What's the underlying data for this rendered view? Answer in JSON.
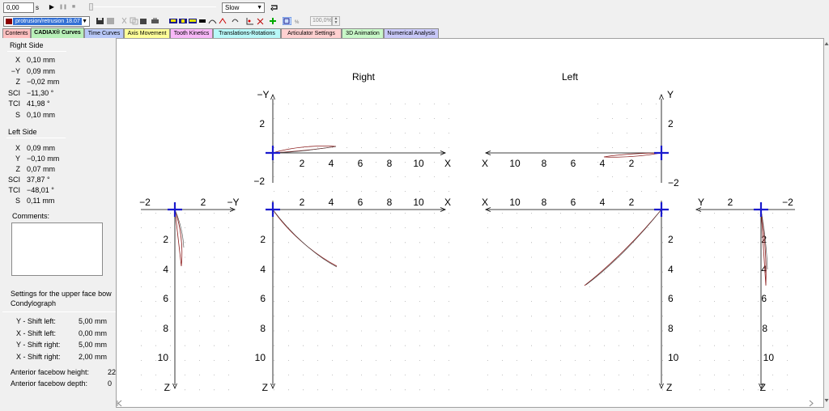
{
  "toolbar": {
    "time_value": "0,00",
    "time_unit": "s",
    "speed_value": "Slow",
    "zoom_value": "100,0%",
    "play_label": "▶",
    "pause_label": "❚❚",
    "stop_label": "■"
  },
  "motion_select": {
    "value": "protrusion/retrusion 18.07"
  },
  "tabs": [
    {
      "label": "Contents",
      "color": "#ffc0c0"
    },
    {
      "label": "CADIAX® Curves",
      "color": "#b8f0b8",
      "active": true
    },
    {
      "label": "Time Curves",
      "color": "#b8c8f8"
    },
    {
      "label": "Axis Movement",
      "color": "#ffff99"
    },
    {
      "label": "Tooth Kinetics",
      "color": "#f8b8f8"
    },
    {
      "label": "Translations-Rotations",
      "color": "#b8f8f8"
    },
    {
      "label": "Articulator Settings",
      "color": "#ffd0d0"
    },
    {
      "label": "3D Animation",
      "color": "#c8f8c8"
    },
    {
      "label": "Numerical Analysis",
      "color": "#c8c8f8"
    }
  ],
  "left_panel": {
    "right_side": {
      "title": "Right Side",
      "rows": [
        {
          "label": "X",
          "value": "0,10 mm"
        },
        {
          "label": "−Y",
          "value": "0,09 mm"
        },
        {
          "label": "Z",
          "value": "−0,02 mm"
        },
        {
          "label": "SCI",
          "value": "−11,30 °"
        },
        {
          "label": "TCI",
          "value": "41,98 °"
        },
        {
          "label": "S",
          "value": "0,10 mm"
        }
      ]
    },
    "left_side": {
      "title": "Left Side",
      "rows": [
        {
          "label": "X",
          "value": "0,09 mm"
        },
        {
          "label": "Y",
          "value": "−0,10 mm"
        },
        {
          "label": "Z",
          "value": "0,07 mm"
        },
        {
          "label": "SCI",
          "value": "37,87 °"
        },
        {
          "label": "TCI",
          "value": "−48,01 °"
        },
        {
          "label": "S",
          "value": "0,11 mm"
        }
      ]
    },
    "comments_label": "Comments:",
    "settings_title": "Settings for the upper face bow",
    "settings_subtitle": "Condylograph",
    "settings": [
      {
        "label": "Y  - Shift left:",
        "value": "5,00 mm"
      },
      {
        "label": "X  - Shift left:",
        "value": "0,00 mm"
      },
      {
        "label": "Y  - Shift right:",
        "value": "5,00 mm"
      },
      {
        "label": "X  - Shift right:",
        "value": "2,00 mm"
      }
    ],
    "facebow": [
      {
        "label": "Anterior facebow height:",
        "value": "22"
      },
      {
        "label": "Anterior facebow depth:",
        "value": "0"
      }
    ]
  },
  "plot": {
    "title_right": "Right",
    "title_left": "Left",
    "axis_labels": {
      "minus_y": "−Y",
      "y": "Y",
      "x": "X",
      "z": "Z"
    },
    "curve_color": "#8b1a1a",
    "marker_color": "#1a1acd",
    "tick_labels": {
      "two": "2",
      "four": "4",
      "six": "6",
      "eight": "8",
      "ten": "10",
      "minus_two": "−2"
    }
  }
}
